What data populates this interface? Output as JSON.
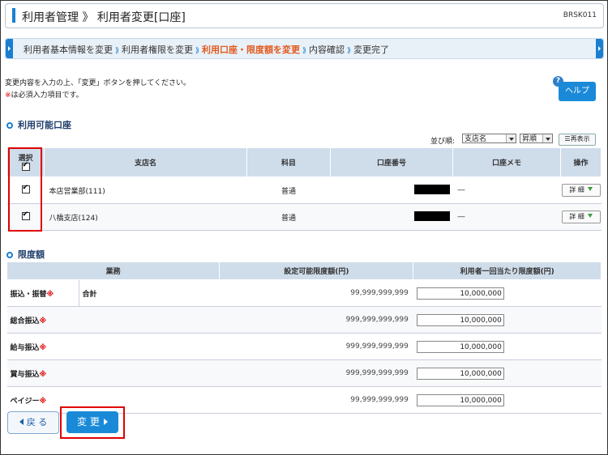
{
  "header": {
    "title": "利用者管理 》 利用者変更[口座]",
    "code": "BRSK011"
  },
  "steps": [
    {
      "label": "利用者基本情報を変更",
      "current": false
    },
    {
      "label": "利用者権限を変更",
      "current": false
    },
    {
      "label": "利用口座・限度額を変更",
      "current": true
    },
    {
      "label": "内容確認",
      "current": false
    },
    {
      "label": "変更完了",
      "current": false
    }
  ],
  "intro": {
    "line1": "変更内容を入力の上、「変更」ボタンを押してください。",
    "line2_mark": "※",
    "line2": "は必須入力項目です。"
  },
  "help": {
    "q": "?",
    "label": "ヘルプ"
  },
  "accounts": {
    "section_title": "利用可能口座",
    "sort_label": "並び順:",
    "sort_field": "支店名",
    "sort_order": "昇順",
    "redisplay": "再表示",
    "headers": {
      "select": "選択",
      "branch": "支店名",
      "subject": "科目",
      "number": "口座番号",
      "memo": "口座メモ",
      "action": "操作"
    },
    "rows": [
      {
        "branch": "本店営業部(111)",
        "subject": "普通",
        "memo": "―",
        "action": "詳 細"
      },
      {
        "branch": "八橋支店(124)",
        "subject": "普通",
        "memo": "―",
        "action": "詳 細"
      }
    ]
  },
  "limits": {
    "section_title": "限度額",
    "headers": {
      "business": "業務",
      "settable": "設定可能限度額(円)",
      "user": "利用者一回当たり限度額(円)"
    },
    "rows": [
      {
        "name": "振込・振替",
        "req": "※",
        "sub": "合計",
        "settable": "99,999,999,999",
        "value": "10,000,000"
      },
      {
        "name": "総合振込",
        "req": "※",
        "sub": "",
        "settable": "999,999,999,999",
        "value": "10,000,000"
      },
      {
        "name": "給与振込",
        "req": "※",
        "sub": "",
        "settable": "999,999,999,999",
        "value": "10,000,000"
      },
      {
        "name": "賞与振込",
        "req": "※",
        "sub": "",
        "settable": "999,999,999,999",
        "value": "10,000,000"
      },
      {
        "name": "ペイジー",
        "req": "※",
        "sub": "",
        "settable": "99,999,999,999",
        "value": "10,000,000"
      }
    ]
  },
  "buttons": {
    "back": "戻 る",
    "change": "変 更"
  }
}
